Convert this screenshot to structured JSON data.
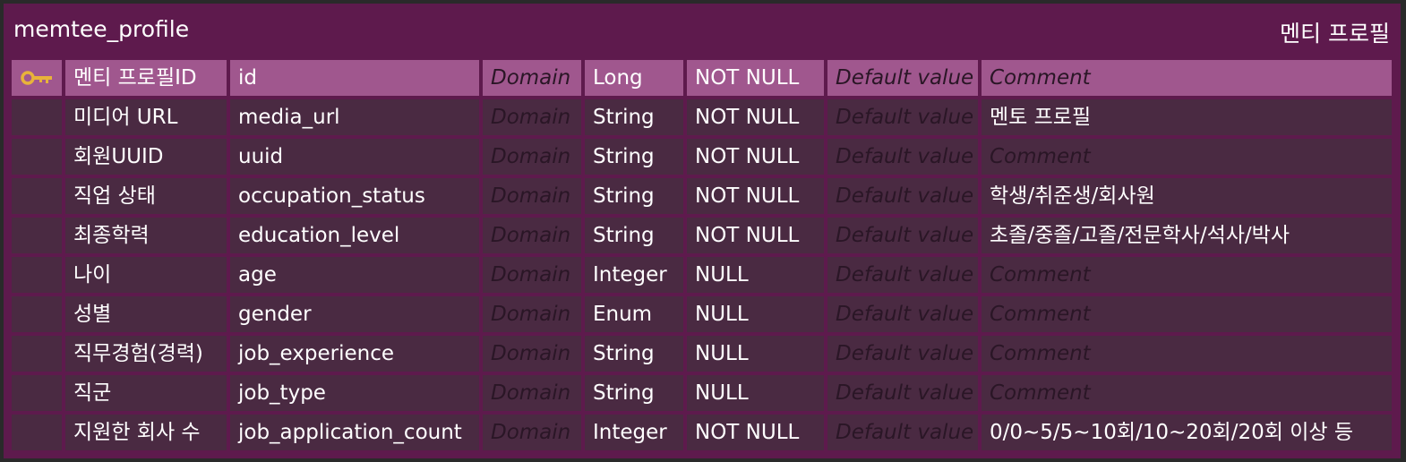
{
  "entity": {
    "name": "memtee_profile",
    "title": "멘티 프로필",
    "primary_key_icon": "key-icon",
    "colors": {
      "frame": "#5e1a4d",
      "row": "#4a2a42",
      "pk_row": "#a0578e",
      "key_icon": "#e8b33a"
    },
    "columns": [
      {
        "logical": "멘티 프로필ID",
        "physical": "id",
        "domain": "Domain",
        "type": "Long",
        "nullable": "NOT NULL",
        "default": "Default value",
        "comment": "Comment",
        "pk": true,
        "comment_set": false
      },
      {
        "logical": "미디어 URL",
        "physical": "media_url",
        "domain": "Domain",
        "type": "String",
        "nullable": "NOT NULL",
        "default": "Default value",
        "comment": "멘토 프로필",
        "pk": false,
        "comment_set": true
      },
      {
        "logical": "회원UUID",
        "physical": "uuid",
        "domain": "Domain",
        "type": "String",
        "nullable": "NOT NULL",
        "default": "Default value",
        "comment": "Comment",
        "pk": false,
        "comment_set": false
      },
      {
        "logical": "직업 상태",
        "physical": "occupation_status",
        "domain": "Domain",
        "type": "String",
        "nullable": "NOT NULL",
        "default": "Default value",
        "comment": "학생/취준생/회사원",
        "pk": false,
        "comment_set": true
      },
      {
        "logical": "최종학력",
        "physical": "education_level",
        "domain": "Domain",
        "type": "String",
        "nullable": "NOT NULL",
        "default": "Default value",
        "comment": "초졸/중졸/고졸/전문학사/석사/박사",
        "pk": false,
        "comment_set": true
      },
      {
        "logical": "나이",
        "physical": "age",
        "domain": "Domain",
        "type": "Integer",
        "nullable": "NULL",
        "default": "Default value",
        "comment": "Comment",
        "pk": false,
        "comment_set": false
      },
      {
        "logical": "성별",
        "physical": "gender",
        "domain": "Domain",
        "type": "Enum",
        "nullable": "NULL",
        "default": "Default value",
        "comment": "Comment",
        "pk": false,
        "comment_set": false
      },
      {
        "logical": "직무경험(경력)",
        "physical": "job_experience",
        "domain": "Domain",
        "type": "String",
        "nullable": "NULL",
        "default": "Default value",
        "comment": "Comment",
        "pk": false,
        "comment_set": false
      },
      {
        "logical": "직군",
        "physical": "job_type",
        "domain": "Domain",
        "type": "String",
        "nullable": "NULL",
        "default": "Default value",
        "comment": "Comment",
        "pk": false,
        "comment_set": false
      },
      {
        "logical": "지원한 회사 수",
        "physical": "job_application_count",
        "domain": "Domain",
        "type": "Integer",
        "nullable": "NOT NULL",
        "default": "Default value",
        "comment": "0/0~5/5~10회/10~20회/20회 이상 등",
        "pk": false,
        "comment_set": true
      }
    ]
  }
}
